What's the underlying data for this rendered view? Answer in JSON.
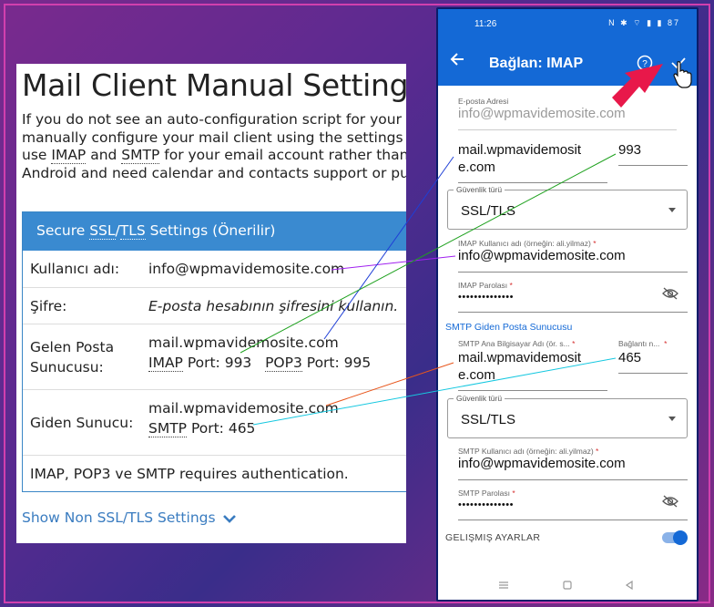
{
  "website": {
    "title": "Mail Client Manual Settings",
    "intro_line1": "If you do not see an auto-configuration script for your client",
    "intro_line2": "manually configure your mail client using the settings below",
    "intro_line3_pre": "use ",
    "intro_line3_imap": "IMAP",
    "intro_line3_and": " and ",
    "intro_line3_smtp": "SMTP",
    "intro_line3_post": " for your email account rather than Active",
    "intro_line4": "Android and need calendar and contacts support or push up",
    "card_header_pre": "Secure ",
    "card_header_ssl": "SSL",
    "card_header_slash": "/",
    "card_header_tls": "TLS",
    "card_header_post": " Settings (Önerilir)",
    "rows": {
      "username_label": "Kullanıcı adı:",
      "username_value": "info@wpmavidemosite.com",
      "password_label": "Şifre:",
      "password_value": "E-posta hesabının şifresini kullanın.",
      "incoming_label_1": "Gelen Posta",
      "incoming_label_2": "Sunucusu:",
      "incoming_host": "mail.wpmavidemosite.com",
      "incoming_imap": "IMAP",
      "incoming_imap_port": " Port: 993",
      "incoming_pop3": "POP3",
      "incoming_pop3_port": " Port: 995",
      "outgoing_label": "Giden Sunucu:",
      "outgoing_host": "mail.wpmavidemosite.com",
      "outgoing_smtp": "SMTP",
      "outgoing_port": " Port: 465",
      "auth_note": "IMAP, POP3 ve SMTP requires authentication."
    },
    "show_non_ssl": "Show Non SSL/TLS Settings"
  },
  "phone": {
    "status_time": "11:26",
    "status_icons": "N ✱ ⌔ ▮ ▮ 87",
    "appbar_title": "Bağlan: IMAP",
    "email_label": "E-posta Adresi",
    "email_value": "info@wpmavidemosite.com",
    "server_value_line1": "mail.wpmavidemosit",
    "server_value_line2": "e.com",
    "port_value": "993",
    "security_label": "Güvenlik türü",
    "security_value": "SSL/TLS",
    "imap_user_label": "IMAP Kullanıcı adı (örneğin: ali.yilmaz)",
    "imap_user_value": "info@wpmavidemosite.com",
    "imap_pass_label": "IMAP Parolası",
    "imap_pass_value": "••••••••••••••",
    "smtp_section": "SMTP Giden Posta Sunucusu",
    "smtp_host_label": "SMTP Ana Bilgisayar Adı (ör. s...",
    "smtp_host_line1": "mail.wpmavidemosit",
    "smtp_host_line2": "e.com",
    "smtp_port_label": "Bağlantı n...",
    "smtp_port_value": "465",
    "smtp_security_label": "Güvenlik türü",
    "smtp_security_value": "SSL/TLS",
    "smtp_user_label": "SMTP Kullanıcı adı (örneğin: ali.yilmaz)",
    "smtp_user_value": "info@wpmavidemosite.com",
    "smtp_pass_label": "SMTP Parolası",
    "smtp_pass_value": "••••••••••••••",
    "advanced_label": "GELIŞMIŞ AYARLAR",
    "required_mark": "*"
  },
  "colors": {
    "brand_blue": "#1469d6",
    "card_header_blue": "#3a8ad0",
    "link_blue": "#3a7cc0",
    "arrow_red": "#e8184a",
    "line_purple": "#a020f0",
    "line_blue": "#1f3fd6",
    "line_green": "#1ea11e",
    "line_orange": "#e8561c",
    "line_cyan": "#16c8e0"
  },
  "icons": [
    "back-arrow-icon",
    "help-icon",
    "check-icon",
    "chevron-down-icon",
    "eye-off-icon",
    "caret-down-icon",
    "pointer-hand-icon"
  ]
}
